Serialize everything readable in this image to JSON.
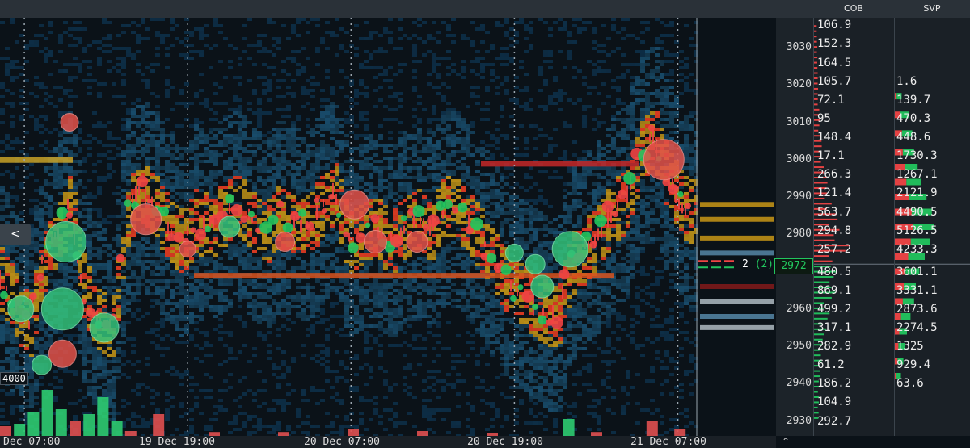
{
  "headers": {
    "cob": "COB",
    "svp": "SVP"
  },
  "collapse_button": "<",
  "current_price": "2972",
  "qty_indicator": {
    "value": "2",
    "paren": "(2)"
  },
  "volume_label": "4000",
  "colors": {
    "bid": "#ef4444",
    "ask": "#22c55e",
    "heat_low": "#0e3a5a",
    "heat_mid": "#d4a017",
    "heat_high": "#e23b22",
    "background": "#0b1218"
  },
  "chart_data": {
    "type": "heatmap",
    "title": "",
    "xlabel": "",
    "ylabel": "",
    "x_ticks": [
      "Dec 07:00",
      "19 Dec 19:00",
      "20 Dec 07:00",
      "20 Dec 19:00",
      "21 Dec 07:00"
    ],
    "y_ticks": [
      3030,
      3020,
      3010,
      3000,
      2990,
      2980,
      2970,
      2960,
      2950,
      2940,
      2930
    ],
    "ylim": [
      2926,
      3038
    ],
    "price_line": 2972,
    "cob": {
      "prices": [
        3036,
        3032,
        3028,
        3024,
        3019,
        3014,
        3009,
        3005,
        3000,
        2996,
        2991,
        2987,
        2982,
        2978,
        2973,
        2969,
        2964,
        2960,
        2955,
        2951,
        2946,
        2942,
        2937,
        2933
      ],
      "values": [
        "106.9",
        "152.3",
        "164.5",
        "105.7",
        "72.1",
        "95",
        "148.4",
        "17.1",
        "266.3",
        "121.4",
        "563.7",
        "294.8",
        "257.2",
        "480.5",
        "869.1",
        "499.2",
        "317.1",
        "282.9",
        "61.2",
        "186.2",
        "104.9",
        "292.7"
      ],
      "value_prices": [
        3036,
        3031,
        3026,
        3021,
        3016,
        3011,
        3006,
        3001,
        2996,
        2991,
        2986,
        2981,
        2976,
        2970,
        2965,
        2960,
        2955,
        2950,
        2945,
        2940,
        2935,
        2930
      ]
    },
    "svp": {
      "values": [
        "1.6",
        "139.7",
        "470.3",
        "448.6",
        "1730.3",
        "1267.1",
        "2121.9",
        "4490.5",
        "5126.5",
        "4233.3",
        "3601.1",
        "3331.1",
        "2873.6",
        "2274.5",
        "1325",
        "929.4",
        "63.6"
      ],
      "value_prices": [
        3021,
        3016,
        3011,
        3006,
        3001,
        2996,
        2991,
        2986,
        2981,
        2976,
        2970,
        2965,
        2960,
        2955,
        2950,
        2945,
        2940
      ],
      "profile": [
        [
          3017,
          0.1
        ],
        [
          3012,
          0.3
        ],
        [
          3007,
          0.4
        ],
        [
          3002,
          0.45
        ],
        [
          2998,
          0.55
        ],
        [
          2994,
          0.65
        ],
        [
          2990,
          0.8
        ],
        [
          2986,
          0.95
        ],
        [
          2982,
          1.0
        ],
        [
          2978,
          0.9
        ],
        [
          2974,
          0.75
        ],
        [
          2970,
          0.6
        ],
        [
          2966,
          0.5
        ],
        [
          2962,
          0.45
        ],
        [
          2958,
          0.35
        ],
        [
          2954,
          0.25
        ],
        [
          2950,
          0.2
        ],
        [
          2946,
          0.15
        ],
        [
          2942,
          0.08
        ]
      ]
    },
    "price_path": [
      [
        0.0,
        2968
      ],
      [
        0.02,
        2962
      ],
      [
        0.04,
        2955
      ],
      [
        0.06,
        2972
      ],
      [
        0.08,
        2980
      ],
      [
        0.1,
        2988
      ],
      [
        0.12,
        2965
      ],
      [
        0.14,
        2958
      ],
      [
        0.16,
        2955
      ],
      [
        0.18,
        2985
      ],
      [
        0.2,
        2992
      ],
      [
        0.22,
        2988
      ],
      [
        0.24,
        2982
      ],
      [
        0.26,
        2978
      ],
      [
        0.28,
        2984
      ],
      [
        0.3,
        2982
      ],
      [
        0.32,
        2986
      ],
      [
        0.34,
        2988
      ],
      [
        0.36,
        2984
      ],
      [
        0.38,
        2980
      ],
      [
        0.4,
        2985
      ],
      [
        0.42,
        2984
      ],
      [
        0.44,
        2982
      ],
      [
        0.46,
        2988
      ],
      [
        0.48,
        2992
      ],
      [
        0.5,
        2978
      ],
      [
        0.52,
        2980
      ],
      [
        0.54,
        2982
      ],
      [
        0.56,
        2978
      ],
      [
        0.58,
        2982
      ],
      [
        0.6,
        2984
      ],
      [
        0.62,
        2982
      ],
      [
        0.64,
        2988
      ],
      [
        0.66,
        2986
      ],
      [
        0.68,
        2982
      ],
      [
        0.7,
        2976
      ],
      [
        0.72,
        2970
      ],
      [
        0.74,
        2965
      ],
      [
        0.76,
        2962
      ],
      [
        0.78,
        2960
      ],
      [
        0.8,
        2958
      ],
      [
        0.82,
        2972
      ],
      [
        0.84,
        2976
      ],
      [
        0.86,
        2980
      ],
      [
        0.88,
        2986
      ],
      [
        0.9,
        2990
      ],
      [
        0.92,
        3002
      ],
      [
        0.94,
        3006
      ],
      [
        0.96,
        2995
      ],
      [
        0.98,
        2988
      ],
      [
        1.0,
        2986
      ]
    ],
    "bubbles": [
      {
        "t": 0.095,
        "p": 2978,
        "r": 25,
        "side": "ask"
      },
      {
        "t": 0.09,
        "p": 2960,
        "r": 26,
        "side": "ask"
      },
      {
        "t": 0.03,
        "p": 2960,
        "r": 16,
        "side": "ask"
      },
      {
        "t": 0.15,
        "p": 2955,
        "r": 18,
        "side": "ask"
      },
      {
        "t": 0.09,
        "p": 2948,
        "r": 17,
        "side": "bid"
      },
      {
        "t": 0.1,
        "p": 3010,
        "r": 11,
        "side": "bid"
      },
      {
        "t": 0.21,
        "p": 2984,
        "r": 19,
        "side": "bid"
      },
      {
        "t": 0.33,
        "p": 2982,
        "r": 13,
        "side": "ask"
      },
      {
        "t": 0.51,
        "p": 2988,
        "r": 18,
        "side": "bid"
      },
      {
        "t": 0.54,
        "p": 2978,
        "r": 14,
        "side": "bid"
      },
      {
        "t": 0.6,
        "p": 2978,
        "r": 13,
        "side": "bid"
      },
      {
        "t": 0.77,
        "p": 2972,
        "r": 12,
        "side": "ask"
      },
      {
        "t": 0.78,
        "p": 2966,
        "r": 14,
        "side": "ask"
      },
      {
        "t": 0.82,
        "p": 2976,
        "r": 22,
        "side": "ask"
      },
      {
        "t": 0.955,
        "p": 3000,
        "r": 25,
        "side": "bid"
      },
      {
        "t": 0.41,
        "p": 2978,
        "r": 12,
        "side": "bid"
      },
      {
        "t": 0.27,
        "p": 2976,
        "r": 10,
        "side": "bid"
      },
      {
        "t": 0.74,
        "p": 2975,
        "r": 11,
        "side": "ask"
      },
      {
        "t": 0.06,
        "p": 2945,
        "r": 12,
        "side": "ask"
      }
    ],
    "volume_bars": [
      [
        0.0,
        0.2,
        "bid"
      ],
      [
        0.02,
        0.25,
        "ask"
      ],
      [
        0.04,
        0.5,
        "ask"
      ],
      [
        0.06,
        0.95,
        "ask"
      ],
      [
        0.08,
        0.55,
        "ask"
      ],
      [
        0.1,
        0.3,
        "bid"
      ],
      [
        0.12,
        0.45,
        "ask"
      ],
      [
        0.14,
        0.8,
        "ask"
      ],
      [
        0.16,
        0.3,
        "ask"
      ],
      [
        0.18,
        0.1,
        "bid"
      ],
      [
        0.22,
        0.45,
        "bid"
      ],
      [
        0.3,
        0.08,
        "bid"
      ],
      [
        0.4,
        0.08,
        "bid"
      ],
      [
        0.5,
        0.15,
        "bid"
      ],
      [
        0.6,
        0.1,
        "bid"
      ],
      [
        0.7,
        0.05,
        "bid"
      ],
      [
        0.81,
        0.35,
        "ask"
      ],
      [
        0.85,
        0.08,
        "bid"
      ],
      [
        0.93,
        0.3,
        "bid"
      ],
      [
        0.97,
        0.15,
        "bid"
      ]
    ],
    "time_gridlines": [
      0.035,
      0.27,
      0.505,
      0.74,
      0.975
    ]
  }
}
